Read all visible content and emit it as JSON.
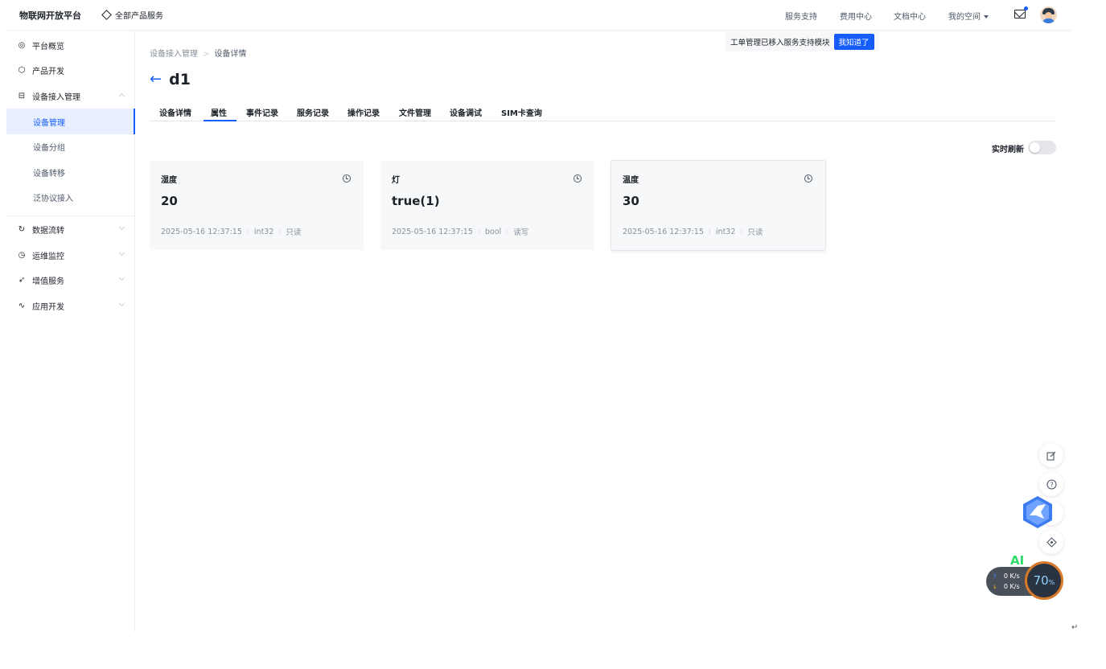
{
  "header": {
    "logo": "物联网开放平台",
    "all_products": "全部产品服务",
    "nav": [
      "服务支持",
      "费用中心",
      "文档中心",
      "我的空间"
    ],
    "notice_text": "工单管理已移入服务支持模块",
    "notice_button": "我知道了"
  },
  "sidebar": {
    "items": [
      {
        "label": "平台概览",
        "icon": "dashboard-icon"
      },
      {
        "label": "产品开发",
        "icon": "cube-icon"
      },
      {
        "label": "设备接入管理",
        "icon": "device-icon"
      },
      {
        "label": "数据流转",
        "icon": "refresh-icon"
      },
      {
        "label": "运维监控",
        "icon": "monitor-icon"
      },
      {
        "label": "增值服务",
        "icon": "send-icon"
      },
      {
        "label": "应用开发",
        "icon": "curve-icon"
      }
    ],
    "sub_items": [
      {
        "label": "设备管理",
        "active": true
      },
      {
        "label": "设备分组",
        "active": false
      },
      {
        "label": "设备转移",
        "active": false
      },
      {
        "label": "泛协议接入",
        "active": false
      }
    ]
  },
  "breadcrumb": {
    "parent": "设备接入管理",
    "current": "设备详情"
  },
  "title": "d1",
  "tabs": [
    "设备详情",
    "属性",
    "事件记录",
    "服务记录",
    "操作记录",
    "文件管理",
    "设备调试",
    "SIM卡查询"
  ],
  "active_tab": "属性",
  "realtime_label": "实时刷新",
  "realtime_on": false,
  "cards": [
    {
      "name": "湿度",
      "value": "20",
      "time": "2025-05-16 12:37:15",
      "type": "int32",
      "access": "只读"
    },
    {
      "name": "灯",
      "value": "true(1)",
      "time": "2025-05-16 12:37:15",
      "type": "bool",
      "access": "读写"
    },
    {
      "name": "温度",
      "value": "30",
      "time": "2025-05-16 12:37:15",
      "type": "int32",
      "access": "只读"
    }
  ],
  "overlay": {
    "ai": "AI",
    "up_speed": "0 K/s",
    "down_speed": "0 K/s",
    "percent": "70",
    "percent_unit": "%"
  },
  "colors": {
    "accent": "#165dff",
    "text": "#1d2129",
    "muted": "#86909c"
  }
}
